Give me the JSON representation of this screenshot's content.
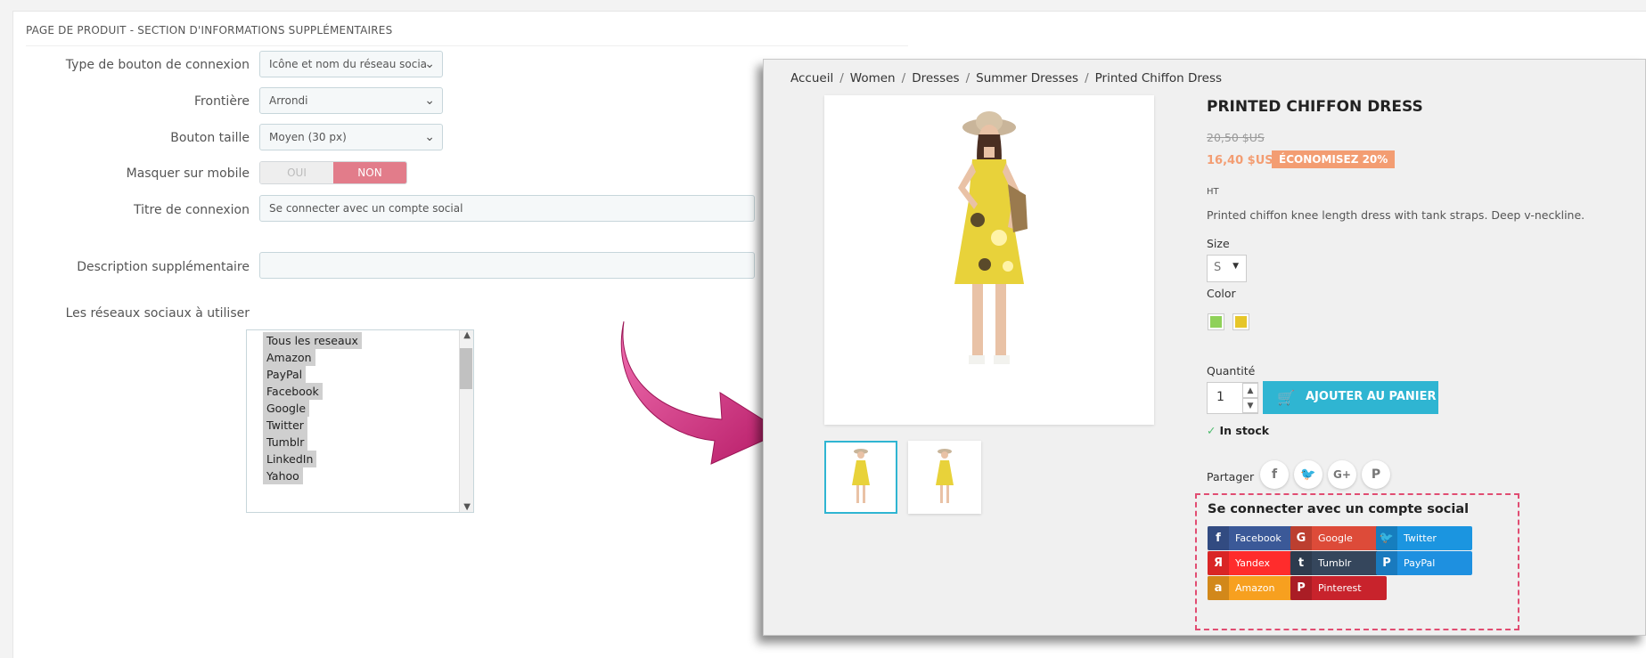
{
  "admin": {
    "title": "PAGE DE PRODUIT - SECTION D'INFORMATIONS SUPPLÉMENTAIRES",
    "fields": {
      "button_type": {
        "label": "Type de bouton de connexion",
        "value": "Icône et nom du réseau socia"
      },
      "border": {
        "label": "Frontière",
        "value": "Arrondi"
      },
      "button_size": {
        "label": "Bouton taille",
        "value": "Moyen (30 px)"
      },
      "hide_mobile": {
        "label": "Masquer sur mobile",
        "off": "OUI",
        "on": "NON"
      },
      "login_title": {
        "label": "Titre de connexion",
        "value": "Se connecter avec un compte social"
      },
      "extra_desc": {
        "label": "Description supplémentaire",
        "value": ""
      },
      "networks": {
        "label": "Les réseaux sociaux à utiliser",
        "options": [
          "Tous les reseaux",
          "Amazon",
          "PayPal",
          "Facebook",
          "Google",
          "Twitter",
          "Tumblr",
          "LinkedIn",
          "Yahoo"
        ]
      }
    }
  },
  "shop": {
    "breadcrumb": [
      "Accueil",
      "Women",
      "Dresses",
      "Summer Dresses",
      "Printed Chiffon Dress"
    ],
    "product": {
      "title": "PRINTED CHIFFON DRESS",
      "old_price": "20,50 $US",
      "new_price": "16,40 $US",
      "discount": "ÉCONOMISEZ 20%",
      "tax": "HT",
      "description": "Printed chiffon knee length dress with tank straps. Deep v-neckline.",
      "size_label": "Size",
      "size_value": "S",
      "color_label": "Color",
      "colors": [
        "#8fd159",
        "#e6c629"
      ],
      "qty_label": "Quantité",
      "qty_value": "1",
      "add_to_cart": "AJOUTER AU PANIER",
      "stock": "In stock",
      "share_label": "Partager",
      "share_icons": [
        "f",
        "🐦",
        "G+",
        "P"
      ]
    },
    "social_login": {
      "title": "Se connecter avec un compte social",
      "buttons": [
        {
          "name": "Facebook",
          "icon": "f",
          "color": "#3b5998"
        },
        {
          "name": "Google",
          "icon": "G",
          "color": "#dd4b39"
        },
        {
          "name": "Twitter",
          "icon": "🐦",
          "color": "#1b95e0"
        },
        {
          "name": "Yandex",
          "icon": "Я",
          "color": "#ff2c2c"
        },
        {
          "name": "Tumblr",
          "icon": "t",
          "color": "#35465c"
        },
        {
          "name": "PayPal",
          "icon": "P",
          "color": "#1e90e0"
        },
        {
          "name": "Amazon",
          "icon": "a",
          "color": "#f7a01f"
        },
        {
          "name": "Pinterest",
          "icon": "P",
          "color": "#c8232c"
        }
      ]
    }
  }
}
